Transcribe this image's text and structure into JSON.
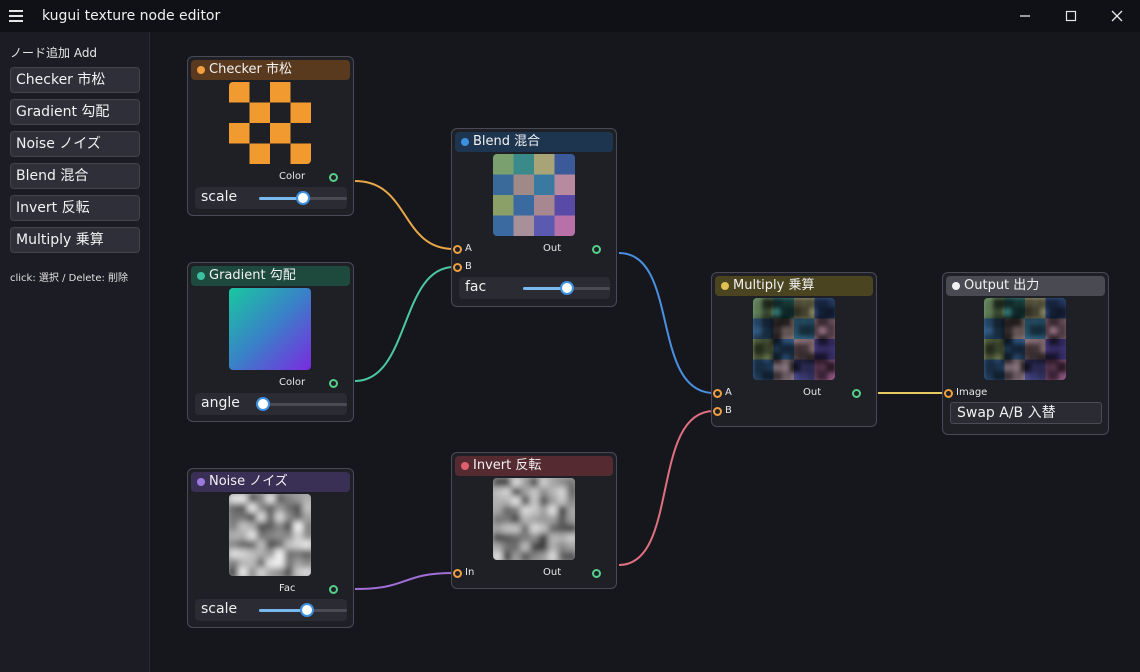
{
  "window": {
    "title": "kugui texture node editor",
    "menu_icon": "hamburger-icon",
    "minimize_icon": "minimize-icon",
    "maximize_icon": "maximize-icon",
    "close_icon": "close-icon"
  },
  "sidebar": {
    "heading": "ノード追加 Add",
    "buttons": [
      "Checker 市松",
      "Gradient 勾配",
      "Noise ノイズ",
      "Blend 混合",
      "Invert 反転",
      "Multiply 乗算"
    ],
    "hint": "click: 選択 / Delete: 削除"
  },
  "nodes": {
    "checker": {
      "title": "Checker 市松",
      "output": "Color",
      "slider_label": "scale",
      "slider_value": 0.5,
      "dot_color": "#f0a040",
      "header_color": "#5a3a1e"
    },
    "gradient": {
      "title": "Gradient 勾配",
      "output": "Color",
      "slider_label": "angle",
      "slider_value": 0.05,
      "dot_color": "#3cc0a0",
      "header_color": "#1e4a3e"
    },
    "noise": {
      "title": "Noise ノイズ",
      "output": "Fac",
      "slider_label": "scale",
      "slider_value": 0.55,
      "dot_color": "#9b7ae0",
      "header_color": "#3a2f55"
    },
    "blend": {
      "title": "Blend 混合",
      "input_a": "A",
      "input_b": "B",
      "output": "Out",
      "slider_label": "fac",
      "slider_value": 0.5,
      "dot_color": "#3d8fe0",
      "header_color": "#1e3550"
    },
    "invert": {
      "title": "Invert 反転",
      "input": "In",
      "output": "Out",
      "dot_color": "#e06070",
      "header_color": "#552a30"
    },
    "multiply": {
      "title": "Multiply 乗算",
      "input_a": "A",
      "input_b": "B",
      "output": "Out",
      "dot_color": "#e0c050",
      "header_color": "#4a4520"
    },
    "output": {
      "title": "Output 出力",
      "input": "Image",
      "button": "Swap A/B 入替",
      "dot_color": "#f0f0f0",
      "header_color": "#4a4b52"
    }
  },
  "colors": {
    "wire_checker": "#e8a848",
    "wire_gradient": "#4cc8a0",
    "wire_noise": "#a070d8",
    "wire_blend": "#4a90e0",
    "wire_invert": "#e07080",
    "wire_output": "#e8c860"
  }
}
